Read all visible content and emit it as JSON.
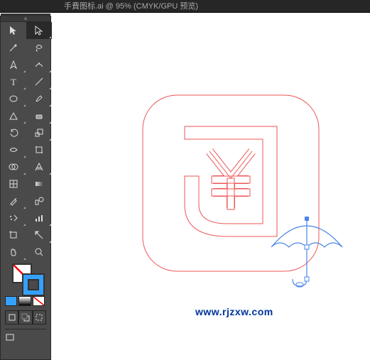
{
  "app": {
    "title": "手費图标.ai @ 95% (CMYK/GPU 预览)"
  },
  "tools": {
    "items": [
      {
        "name": "selection-tool",
        "interactable": true
      },
      {
        "name": "direct-selection-tool",
        "interactable": true,
        "selected": true
      },
      {
        "name": "magic-wand-tool",
        "interactable": true
      },
      {
        "name": "lasso-tool",
        "interactable": true
      },
      {
        "name": "pen-tool",
        "interactable": true
      },
      {
        "name": "curvature-tool",
        "interactable": true
      },
      {
        "name": "type-tool",
        "interactable": true
      },
      {
        "name": "line-segment-tool",
        "interactable": true
      },
      {
        "name": "ellipse-tool",
        "interactable": true
      },
      {
        "name": "paintbrush-tool",
        "interactable": true
      },
      {
        "name": "shaper-tool",
        "interactable": true
      },
      {
        "name": "eraser-tool",
        "interactable": true
      },
      {
        "name": "rotate-tool",
        "interactable": true
      },
      {
        "name": "scale-tool",
        "interactable": true
      },
      {
        "name": "width-tool",
        "interactable": true
      },
      {
        "name": "free-transform-tool",
        "interactable": true
      },
      {
        "name": "shape-builder-tool",
        "interactable": true
      },
      {
        "name": "perspective-grid-tool",
        "interactable": true
      },
      {
        "name": "mesh-tool",
        "interactable": true
      },
      {
        "name": "gradient-tool",
        "interactable": true
      },
      {
        "name": "eyedropper-tool",
        "interactable": true
      },
      {
        "name": "blend-tool",
        "interactable": true
      },
      {
        "name": "symbol-sprayer-tool",
        "interactable": true
      },
      {
        "name": "column-graph-tool",
        "interactable": true
      },
      {
        "name": "artboard-tool",
        "interactable": true
      },
      {
        "name": "slice-tool",
        "interactable": true
      },
      {
        "name": "hand-tool",
        "interactable": true
      },
      {
        "name": "zoom-tool",
        "interactable": true
      }
    ]
  },
  "colors": {
    "fill": "none",
    "stroke": "#36a0ff",
    "swatches": [
      "#36a0ff",
      "gradient",
      "none"
    ]
  },
  "canvas": {
    "watermark": "www.rjzxw.com",
    "shapes": {
      "outer_rect_stroke": "#e74c3c",
      "yen_path_stroke": "#e74c3c",
      "umbrella_stroke": "#4a86e8"
    }
  }
}
